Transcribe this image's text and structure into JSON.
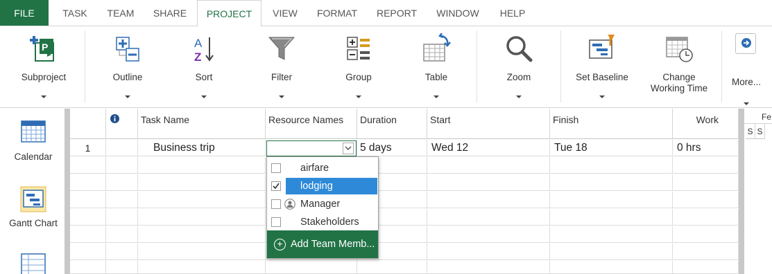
{
  "tabs": [
    "FILE",
    "TASK",
    "TEAM",
    "SHARE",
    "PROJECT",
    "VIEW",
    "FORMAT",
    "REPORT",
    "WINDOW",
    "HELP"
  ],
  "active_tab": "PROJECT",
  "ribbon": {
    "subproject": "Subproject",
    "outline": "Outline",
    "sort": "Sort",
    "filter": "Filter",
    "group": "Group",
    "table": "Table",
    "zoom": "Zoom",
    "set_baseline": "Set Baseline",
    "change_working_time": "Change Working Time",
    "more": "More..."
  },
  "views": [
    "Calendar",
    "Gantt Chart",
    ""
  ],
  "grid": {
    "info_icon": "info-icon",
    "headers": [
      "Task Name",
      "Resource Names",
      "Duration",
      "Start",
      "Finish",
      "Work"
    ],
    "rows": [
      {
        "num": "1",
        "task": "Business trip",
        "duration": "5 days",
        "start": "Wed 12",
        "finish": "Tue 18",
        "work": "0 hrs"
      }
    ]
  },
  "timeline": {
    "month": "Fe",
    "days": [
      "S",
      "S"
    ]
  },
  "resource_dropdown": {
    "options": [
      {
        "label": "airfare",
        "checked": false,
        "selected": false
      },
      {
        "label": "lodging",
        "checked": true,
        "selected": true
      },
      {
        "label": "Manager",
        "checked": false,
        "selected": false,
        "icon": "person-icon"
      },
      {
        "label": "Stakeholders",
        "checked": false,
        "selected": false
      }
    ],
    "add_label": "Add Team Memb..."
  },
  "colors": {
    "accent": "#217346",
    "selection": "#2e8ad8"
  }
}
